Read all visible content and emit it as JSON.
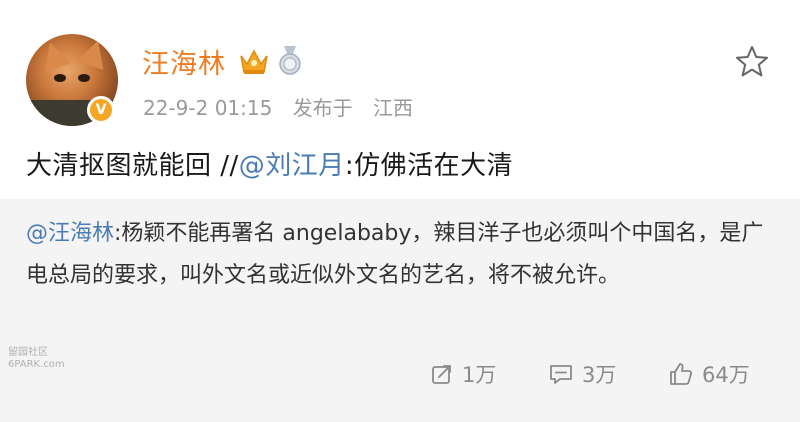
{
  "post": {
    "username": "汪海林",
    "timestamp": "22-9-2 01:15",
    "published_label": "发布于",
    "location": "江西",
    "verified_mark": "V",
    "text_before": "大清抠图就能回 //",
    "mention": "@刘江月",
    "text_after": ":仿佛活在大清"
  },
  "quoted": {
    "mention": "@汪海林",
    "text": ":杨颖不能再署名 angelababy，辣目洋子也必须叫个中国名，是广电总局的要求，叫外文名或近似外文名的艺名，将不被允许。"
  },
  "watermark": {
    "line1": "留园社区",
    "line2": "6PARK.com"
  },
  "actions": {
    "repost_count": "1万",
    "comment_count": "3万",
    "like_count": "64万"
  },
  "colors": {
    "username": "#f07b1e",
    "mention": "#4a7bb5",
    "quote_bg": "#f4f4f4",
    "muted": "#9a9a9a"
  },
  "icons": {
    "favorite": "star-outline-icon",
    "repost": "repost-icon",
    "comment": "comment-icon",
    "like": "thumbs-up-icon",
    "vip": "crown-icon",
    "medal": "medal-icon"
  }
}
